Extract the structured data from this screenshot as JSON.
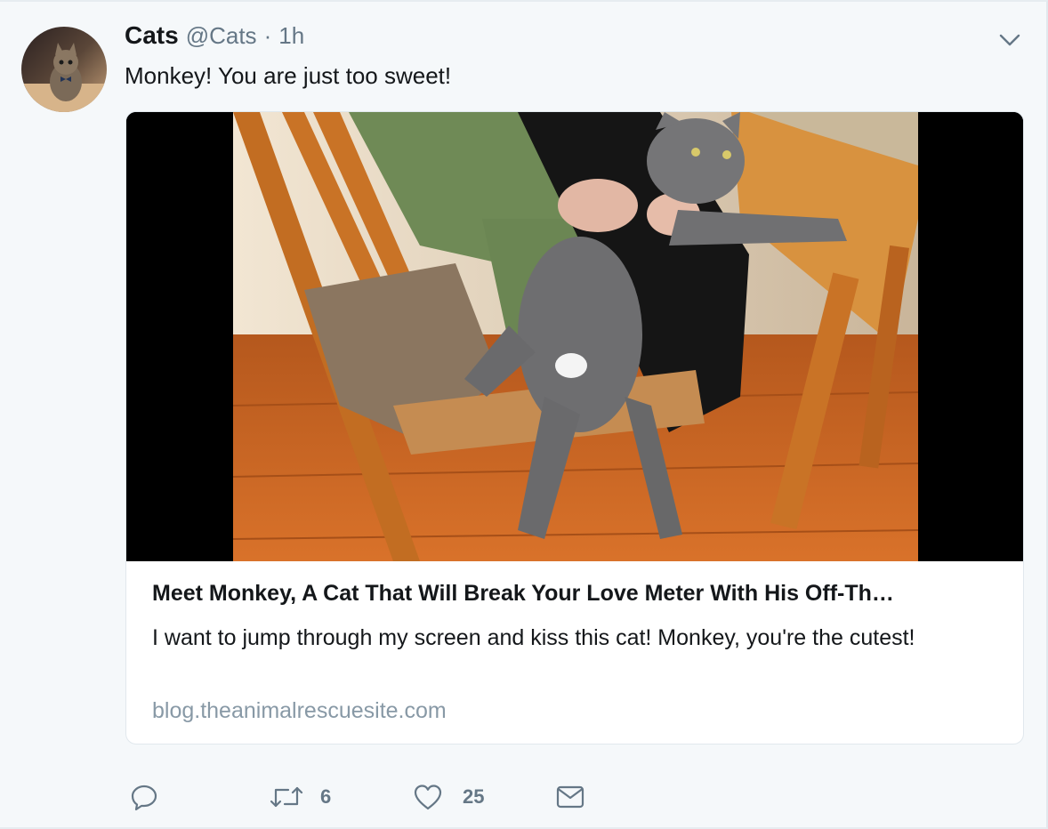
{
  "tweet": {
    "author_name": "Cats",
    "handle": "@Cats",
    "separator": "·",
    "time": "1h",
    "text": "Monkey! You are just too sweet!",
    "card": {
      "title": "Meet Monkey, A Cat That Will Break Your Love Meter With His Off-Th…",
      "description": "I want to jump through my screen and kiss this cat! Monkey, you're the cutest!",
      "domain": "blog.theanimalrescuesite.com"
    },
    "actions": {
      "reply_count": "",
      "retweet_count": "6",
      "like_count": "25"
    }
  },
  "icons": {
    "caret": "chevron-down-icon",
    "reply": "reply-icon",
    "retweet": "retweet-icon",
    "like": "heart-icon",
    "dm": "envelope-icon"
  },
  "colors": {
    "background": "#f5f8fa",
    "text": "#14171a",
    "secondary": "#657786",
    "domain": "#8899a6",
    "border": "#e1e8ed"
  }
}
